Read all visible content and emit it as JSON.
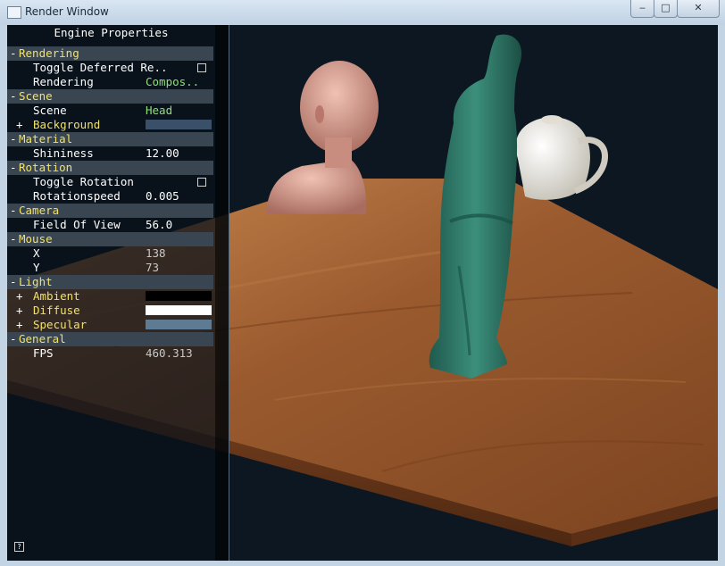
{
  "window": {
    "title": "Render Window",
    "controls": {
      "minimize": "‒",
      "maximize": "□",
      "close": "✕"
    }
  },
  "panel": {
    "title": "Engine Properties",
    "help": "?",
    "groups": {
      "rendering": {
        "label": "Rendering",
        "sign": "-"
      },
      "scene": {
        "label": "Scene",
        "sign": "-"
      },
      "material": {
        "label": "Material",
        "sign": "-"
      },
      "rotation": {
        "label": "Rotation",
        "sign": "-"
      },
      "camera": {
        "label": "Camera",
        "sign": "-"
      },
      "mouse": {
        "label": "Mouse",
        "sign": "-"
      },
      "light": {
        "label": "Light",
        "sign": "-"
      },
      "general": {
        "label": "General",
        "sign": "-"
      }
    },
    "properties": {
      "toggle_deferred": {
        "label": "Toggle Deferred Re..",
        "checked": false
      },
      "rendering_mode": {
        "label": "Rendering",
        "value": "Compos.."
      },
      "scene_name": {
        "label": "Scene",
        "value": "Head"
      },
      "background": {
        "label": "Background",
        "expander": "+",
        "color": "#3a5068"
      },
      "shininess": {
        "label": "Shininess",
        "value": "12.00"
      },
      "toggle_rotation": {
        "label": "Toggle Rotation",
        "checked": false
      },
      "rotation_speed": {
        "label": "Rotationspeed",
        "value": "0.005"
      },
      "fov": {
        "label": "Field Of View",
        "value": "56.0"
      },
      "mouse_x": {
        "label": "X",
        "value": "138"
      },
      "mouse_y": {
        "label": "Y",
        "value": "73"
      },
      "ambient": {
        "label": "Ambient",
        "expander": "+",
        "color": "#000000"
      },
      "diffuse": {
        "label": "Diffuse",
        "expander": "+",
        "color": "#ffffff"
      },
      "specular": {
        "label": "Specular",
        "expander": "+",
        "color": "#5f7a93"
      },
      "fps": {
        "label": "FPS",
        "value": "460.313"
      }
    }
  },
  "scene_colors": {
    "background": "#0c1722",
    "table_top": "#9a5a2e",
    "table_edge": "#6b3a1c",
    "skin": "#d9a294",
    "statue": "#2f7a6a",
    "teapot": "#e9e7df"
  }
}
